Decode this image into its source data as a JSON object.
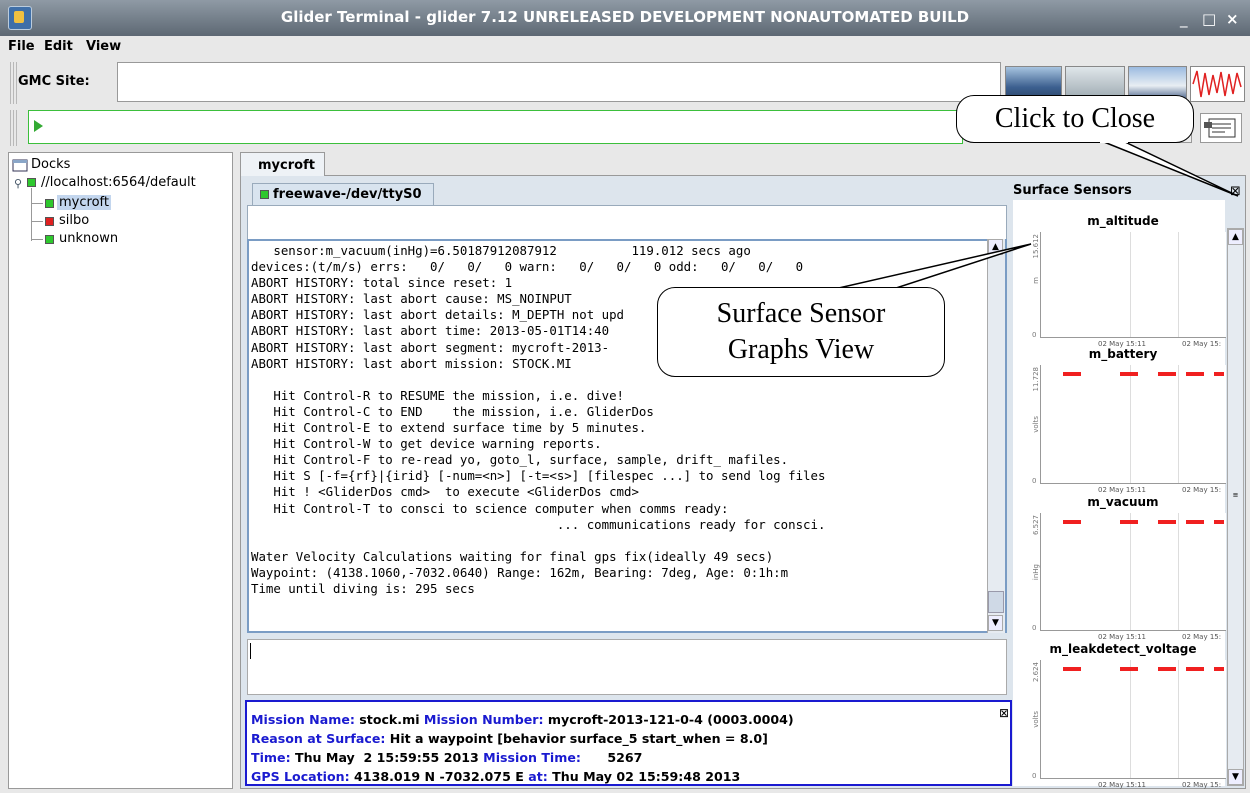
{
  "window": {
    "title": "Glider Terminal - glider 7.12  UNRELEASED DEVELOPMENT NONAUTOMATED BUILD",
    "minimize": "_",
    "maximize": "□",
    "close": "×"
  },
  "menu": [
    "File",
    "Edit",
    "View"
  ],
  "gmc": {
    "label": "GMC Site:",
    "value": ""
  },
  "tree": {
    "root": "Docks",
    "server": "//localhost:6564/default",
    "items": [
      {
        "label": "mycroft",
        "status": "green"
      },
      {
        "label": "silbo",
        "status": "red"
      },
      {
        "label": "unknown",
        "status": "green"
      }
    ]
  },
  "tabs": {
    "main": "mycroft",
    "sub": "freewave-/dev/ttyS0"
  },
  "terminal": {
    "lines": [
      "   sensor:m_vacuum(inHg)=6.50187912087912          119.012 secs ago",
      "devices:(t/m/s) errs:   0/   0/   0 warn:   0/   0/   0 odd:   0/   0/   0",
      "ABORT HISTORY: total since reset: 1",
      "ABORT HISTORY: last abort cause: MS_NOINPUT",
      "ABORT HISTORY: last abort details: M_DEPTH not upd",
      "ABORT HISTORY: last abort time: 2013-05-01T14:40",
      "ABORT HISTORY: last abort segment: mycroft-2013-",
      "ABORT HISTORY: last abort mission: STOCK.MI",
      "",
      "   Hit Control-R to RESUME the mission, i.e. dive!",
      "   Hit Control-C to END    the mission, i.e. GliderDos",
      "   Hit Control-E to extend surface time by 5 minutes.",
      "   Hit Control-W to get device warning reports.",
      "   Hit Control-F to re-read yo, goto_l, surface, sample, drift_ mafiles.",
      "   Hit S [-f={rf}|{irid} [-num=<n>] [-t=<s>] [filespec ...] to send log files",
      "   Hit ! <GliderDos cmd>  to execute <GliderDos cmd>",
      "   Hit Control-T to consci to science computer when comms ready:",
      "                                         ... communications ready for consci.",
      "",
      "Water Velocity Calculations waiting for final gps fix(ideally 49 secs)",
      "Waypoint: (4138.1060,-7032.0640) Range: 162m, Bearing: 7deg, Age: 0:1h:m",
      "Time until diving is: 295 secs"
    ]
  },
  "mission": {
    "name_label": "Mission Name:",
    "name": "stock.mi",
    "number_label": "Mission Number:",
    "number": "mycroft-2013-121-0-4 (0003.0004)",
    "reason_label": "Reason at Surface:",
    "reason": "Hit a waypoint [behavior surface_5 start_when = 8.0]",
    "time_label": "Time:",
    "time": "Thu May  2 15:59:55 2013",
    "mtime_label": "Mission Time:",
    "mtime": "5267",
    "gps_label": "GPS Location:",
    "gps": "4138.019 N -7032.075 E",
    "at_label": "at:",
    "at": "Thu May 02 15:59:48 2013",
    "close_icon": "⊠"
  },
  "sensors": {
    "title": "Surface Sensors",
    "close_icon": "⊠",
    "graphs": [
      {
        "name": "m_altitude",
        "unit": "m",
        "ymax_label": "15.612",
        "ymin_label": "0",
        "ticks": [
          "02 May 15:11",
          "02 May 15:"
        ],
        "series_color": "#f02020",
        "has_data": false
      },
      {
        "name": "m_battery",
        "unit": "volts",
        "ymax_label": "11.728",
        "ymin_label": "0",
        "ticks": [
          "02 May 15:11",
          "02 May 15:"
        ],
        "series_color": "#f02020",
        "has_data": true
      },
      {
        "name": "m_vacuum",
        "unit": "inHg",
        "ymax_label": "6.527",
        "ymin_label": "0",
        "ticks": [
          "02 May 15:11",
          "02 May 15:"
        ],
        "series_color": "#f02020",
        "has_data": true
      },
      {
        "name": "m_leakdetect_voltage",
        "unit": "volts",
        "ymax_label": "2.624",
        "ymin_label": "0",
        "ticks": [
          "02 May 15:11",
          "02 May 15:"
        ],
        "series_color": "#f02020",
        "has_data": true
      }
    ]
  },
  "callouts": {
    "close": "Click to Close",
    "graphs": "Surface Sensor Graphs View"
  }
}
